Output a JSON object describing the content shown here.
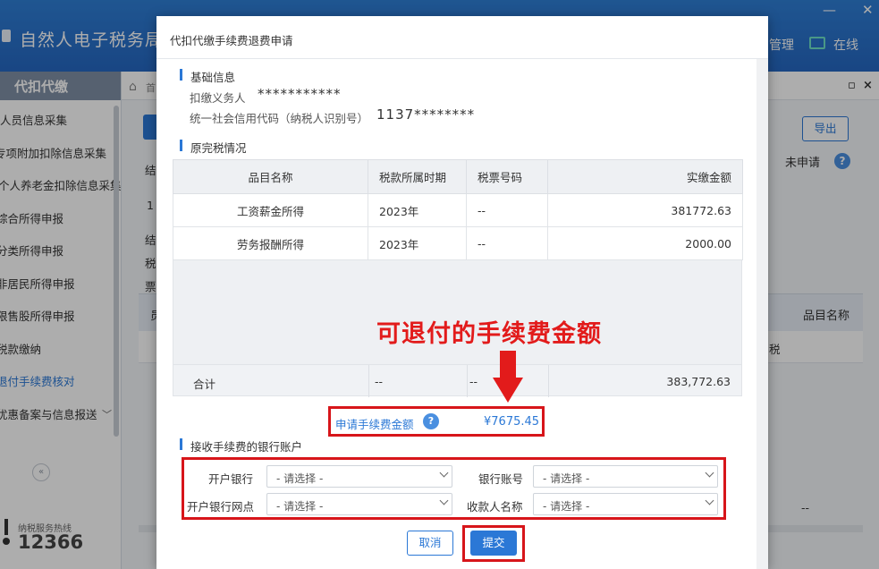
{
  "app": {
    "title": "自然人电子税务局",
    "right_menu": "管理",
    "online_label": "在线",
    "minimize": "—",
    "close": "✕"
  },
  "sidebar": {
    "header": "代扣代缴",
    "items": [
      {
        "label": "人员信息采集"
      },
      {
        "label": "专项附加扣除信息采集"
      },
      {
        "label": "个人养老金扣除信息采集"
      },
      {
        "label": "综合所得申报"
      },
      {
        "label": "分类所得申报"
      },
      {
        "label": "非居民所得申报"
      },
      {
        "label": "限售股所得申报"
      },
      {
        "label": "税款缴纳"
      },
      {
        "label": "退付手续费核对"
      },
      {
        "label": "优惠备案与信息报送"
      }
    ],
    "collapse": "«",
    "hotline_label": "纳税服务热线",
    "hotline_number": "12366"
  },
  "content": {
    "breadcrumb_home": "首",
    "tab_restore": "▫",
    "tab_close": "×",
    "export_label": "导出",
    "status_text": "未申请",
    "help": "?",
    "fragments": [
      "结",
      "1",
      "结",
      "税",
      "票",
      "员"
    ],
    "table_header_last": "品目名称",
    "row_fragment": "税",
    "footer_dash": "--"
  },
  "dialog": {
    "title": "代扣代缴手续费退费申请",
    "basic_section": "基础信息",
    "withholding_agent_label": "扣缴义务人",
    "withholding_agent_value": "***********",
    "credit_code_label": "统一社会信用代码（纳税人识别号）",
    "credit_code_value": "1137********",
    "tax_section": "原完税情况",
    "columns": [
      "品目名称",
      "税款所属时期",
      "税票号码",
      "实缴金额"
    ],
    "rows": [
      {
        "item": "工资薪金所得",
        "period": "2023年",
        "ticket": "--",
        "amount": "381772.63"
      },
      {
        "item": "劳务报酬所得",
        "period": "2023年",
        "ticket": "--",
        "amount": "2000.00"
      }
    ],
    "total": {
      "label": "合计",
      "period": "--",
      "ticket": "--",
      "amount": "383,772.63"
    },
    "fee_label": "申请手续费金额",
    "fee_help": "?",
    "fee_value": "¥7675.45",
    "bank_section": "接收手续费的银行账户",
    "fields": {
      "bank_label": "开户银行",
      "account_label": "银行账号",
      "branch_label": "开户银行网点",
      "payee_label": "收款人名称",
      "placeholder": "- 请选择 -"
    },
    "cancel_label": "取消",
    "submit_label": "提交"
  },
  "annotation": {
    "callout_text": "可退付的手续费金额",
    "color": "#e21b1b"
  }
}
